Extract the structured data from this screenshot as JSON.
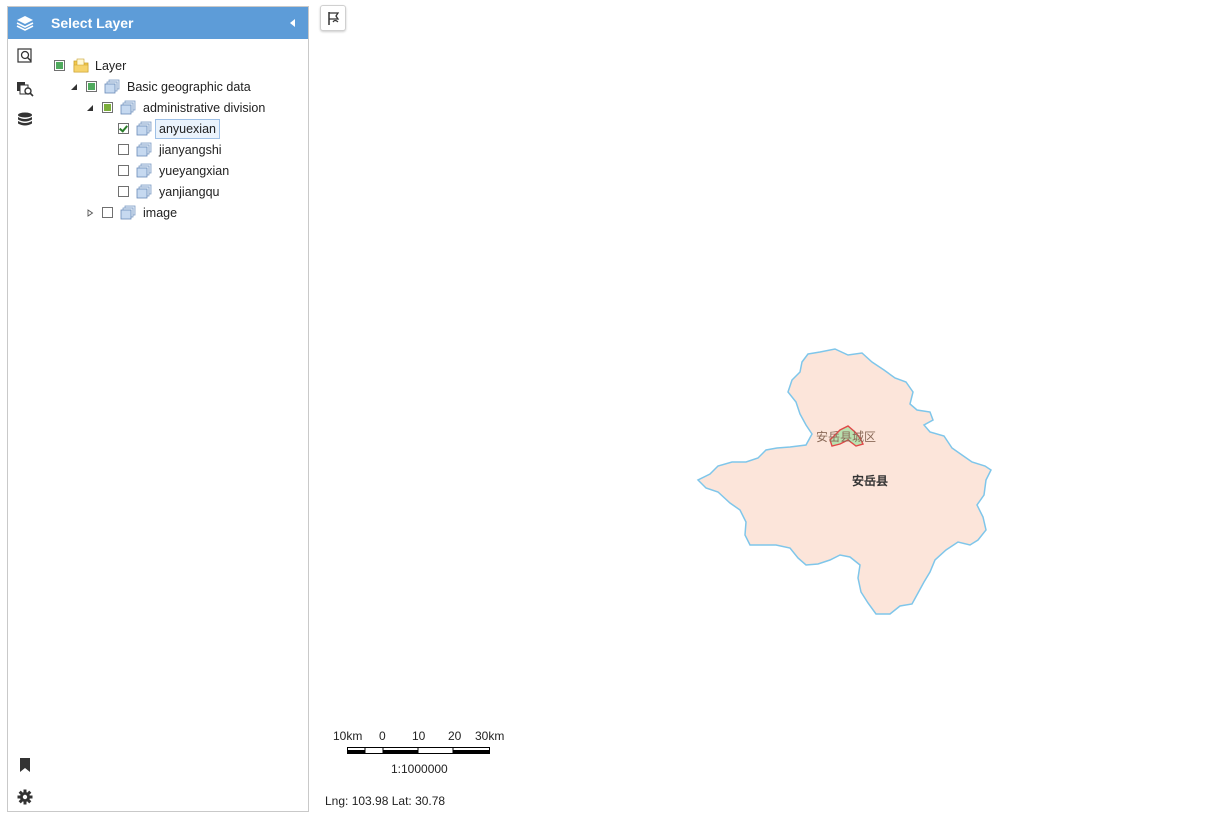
{
  "panel": {
    "title": "Select Layer",
    "header_icon": "layers-icon",
    "collapse_icon": "triangle-left-icon"
  },
  "tools": [
    {
      "name": "zoom-search-icon"
    },
    {
      "name": "layer-search-icon"
    },
    {
      "name": "database-icon"
    },
    {
      "name": "bookmark-icon"
    },
    {
      "name": "gear-icon"
    }
  ],
  "tree": {
    "root": {
      "label": "Layer",
      "state": "partial"
    },
    "group": {
      "label": "Basic geographic data",
      "state": "partial",
      "expanded": true
    },
    "subgroup": {
      "label": "administrative division",
      "state": "partial",
      "expanded": true
    },
    "layers": [
      {
        "label": "anyuexian",
        "checked": true,
        "selected": true
      },
      {
        "label": "jianyangshi",
        "checked": false
      },
      {
        "label": "yueyangxian",
        "checked": false
      },
      {
        "label": "yanjiangqu",
        "checked": false
      }
    ],
    "image": {
      "label": "image",
      "checked": false,
      "expanded": false
    }
  },
  "map": {
    "region_label": "安岳县",
    "urban_label": "安岳县城区",
    "region_fill": "#fce5da",
    "region_stroke": "#7fc6ea",
    "urban_stroke": "#e04848",
    "urban_fill": "#b9e2b0"
  },
  "scale": {
    "ticks": [
      "10km",
      "0",
      "10",
      "20",
      "30km"
    ],
    "ratio": "1:1000000"
  },
  "coords": "Lng: 103.98 Lat: 30.78",
  "colors": {
    "header": "#5d9cd8",
    "checkbox_green": "#4faa5d"
  }
}
